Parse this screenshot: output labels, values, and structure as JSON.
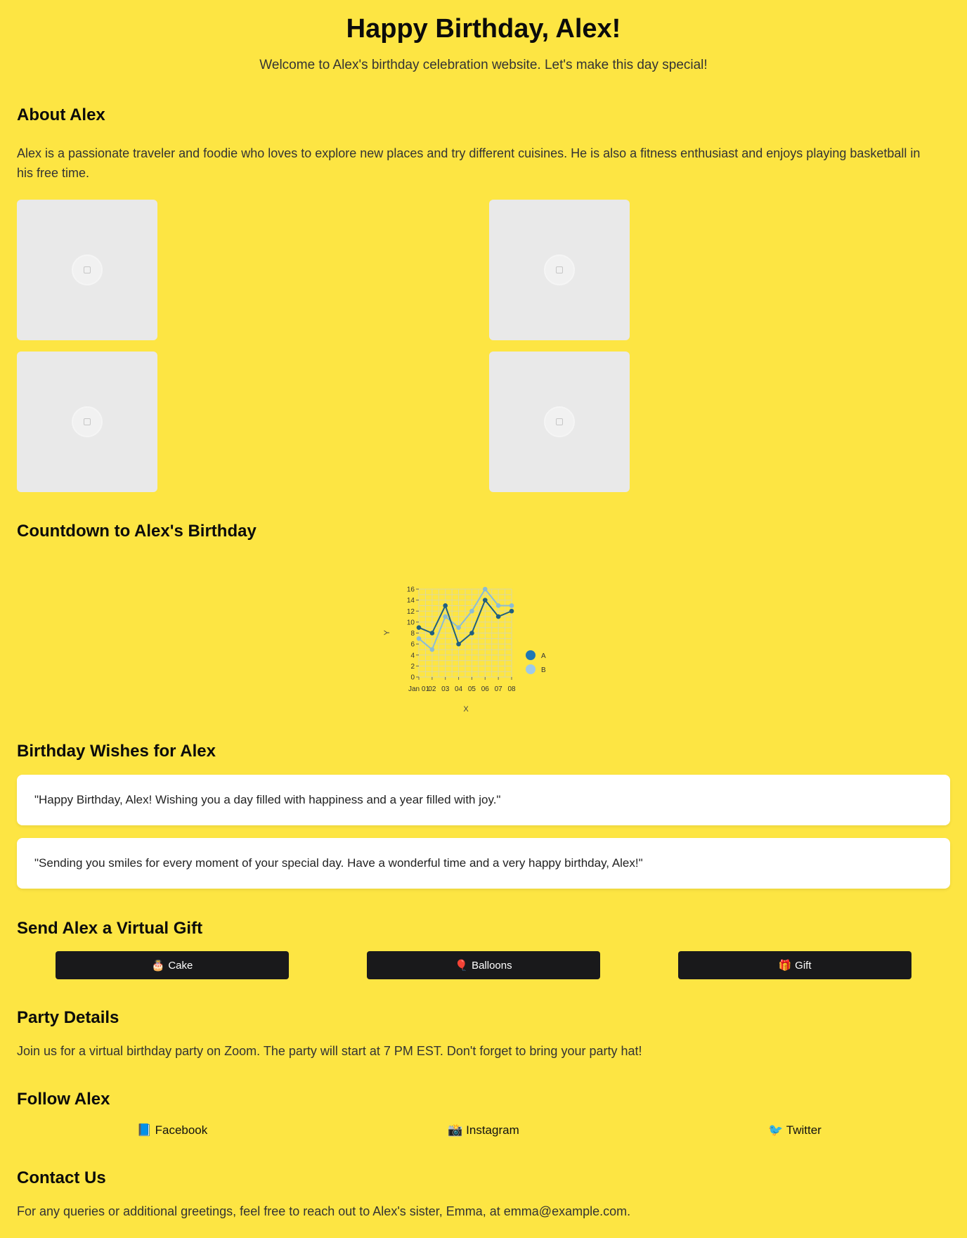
{
  "hero": {
    "title": "Happy Birthday, Alex!",
    "subtitle": "Welcome to Alex's birthday celebration website. Let's make this day special!"
  },
  "about": {
    "heading": "About Alex",
    "text": "Alex is a passionate traveler and foodie who loves to explore new places and try different cuisines. He is also a fitness enthusiast and enjoys playing basketball in his free time.",
    "photos": [
      {
        "icon": "image-placeholder-icon"
      },
      {
        "icon": "image-placeholder-icon"
      },
      {
        "icon": "image-placeholder-icon"
      },
      {
        "icon": "image-placeholder-icon"
      }
    ]
  },
  "countdown": {
    "heading": "Countdown to Alex's Birthday"
  },
  "chart_data": {
    "type": "line",
    "x": [
      "Jan 01",
      "Jan 02",
      "Jan 03",
      "Jan 04",
      "Jan 05",
      "Jan 06",
      "Jan 07",
      "Jan 08"
    ],
    "xticks": [
      "Jan 01",
      "02",
      "03",
      "04",
      "05",
      "06",
      "07",
      "08"
    ],
    "series": [
      {
        "name": "A",
        "color": "#1f5f80",
        "values": [
          9,
          8,
          13,
          6,
          8,
          14,
          11,
          12
        ]
      },
      {
        "name": "B",
        "color": "#8bbcd6",
        "values": [
          7,
          5,
          11,
          9,
          12,
          16,
          13,
          13
        ]
      }
    ],
    "xlabel": "X",
    "ylabel": "Y",
    "ylim": [
      0,
      16
    ],
    "yticks": [
      0,
      2,
      4,
      6,
      8,
      10,
      12,
      14,
      16
    ],
    "grid": true,
    "legend": "right",
    "legend_colors": [
      "#1f77b4",
      "#9ecae9"
    ]
  },
  "wishes": {
    "heading": "Birthday Wishes for Alex",
    "items": [
      "\"Happy Birthday, Alex! Wishing you a day filled with happiness and a year filled with joy.\"",
      "\"Sending you smiles for every moment of your special day. Have a wonderful time and a very happy birthday, Alex!\""
    ]
  },
  "gifts": {
    "heading": "Send Alex a Virtual Gift",
    "buttons": [
      {
        "emoji": "🎂",
        "label": "Cake"
      },
      {
        "emoji": "🎈",
        "label": "Balloons"
      },
      {
        "emoji": "🎁",
        "label": "Gift"
      }
    ]
  },
  "party": {
    "heading": "Party Details",
    "text": "Join us for a virtual birthday party on Zoom. The party will start at 7 PM EST. Don't forget to bring your party hat!"
  },
  "follow": {
    "heading": "Follow Alex",
    "links": [
      {
        "emoji": "📘",
        "label": "Facebook"
      },
      {
        "emoji": "📸",
        "label": "Instagram"
      },
      {
        "emoji": "🐦",
        "label": "Twitter"
      }
    ]
  },
  "contact": {
    "heading": "Contact Us",
    "text": "For any queries or additional greetings, feel free to reach out to Alex's sister, Emma, at emma@example.com."
  },
  "colors": {
    "background": "#fde543",
    "button": "#19191b",
    "card": "#ffffff",
    "photo_placeholder": "#e9e9e9"
  }
}
